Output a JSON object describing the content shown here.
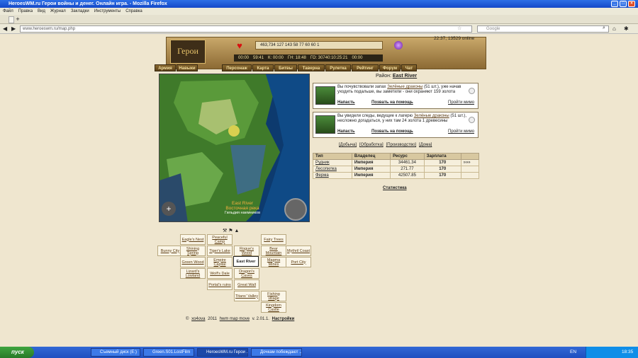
{
  "window": {
    "title": "HeroesWM.ru Герои войны и денег. Онлайн игра. - Mozilla Firefox"
  },
  "menubar": [
    "Файл",
    "Правка",
    "Вид",
    "Журнал",
    "Закладки",
    "Инструменты",
    "Справка"
  ],
  "browser": {
    "url": "www.heroeswm.ru/map.php",
    "search_placeholder": "Google"
  },
  "header": {
    "logo": "Герои",
    "online": "22:37, 13529 online",
    "resources": "463,734  127  143  58  77  60  60  1",
    "timers": [
      "00:00",
      "59:41",
      "К: 00:00",
      "ГН: 18:48",
      "ГО: 30740:10:25:21",
      "00:00"
    ]
  },
  "nav": [
    "Армия",
    "Навыки",
    "Персонаж",
    "Карта",
    "Битвы",
    "Таверна",
    "Рулетка",
    "Рейтинг",
    "Форум",
    "Чат"
  ],
  "map": {
    "label": "East River",
    "sub": "Восточная река",
    "sub2": "Гильдия наемников"
  },
  "region": {
    "label": "Район:",
    "name": "East River"
  },
  "events": [
    {
      "text_pre": "Вы почувствовали запах ",
      "link": "Зелёные драконы",
      "text_post": " (51 шт.), уже начав уходить подальше, вы заметили - они охраняют 159 золота",
      "attack": "Напасть",
      "help": "Позвать на помощь",
      "pass": "Пройти мимо"
    },
    {
      "text_pre": "Вы увидели следы, ведущие к лагерю ",
      "link": "Зелёные драконы",
      "text_post": " (51 шт.), несложно догадаться, у них там 24 золота 1 древесины",
      "attack": "Напасть",
      "help": "Позвать на помощь",
      "pass": "Пройти мимо"
    }
  ],
  "subtabs": [
    "[Добыча]",
    "[Обработка]",
    "[Производство]",
    "[Дома]"
  ],
  "table": {
    "headers": [
      "Тип",
      "Владелец",
      "Ресурс",
      "Зарплата",
      ""
    ],
    "rows": [
      [
        "Рудник",
        "Империя",
        "34461.34",
        "170",
        "»»»"
      ],
      [
        "Лесопилка",
        "Империя",
        "271.77",
        "170",
        ""
      ],
      [
        "Ферма",
        "Империя",
        "42507.85",
        "170",
        ""
      ]
    ]
  },
  "stat": "Статистика",
  "grid": {
    "eagle": "Eagle's Nest",
    "peaceful": "Peaceful Camp",
    "fairy": "Fairy Trees",
    "bunny": "Bunny City",
    "shining": "Shining Spring",
    "tiger": "Tiger's Lake",
    "rogues": "Rogue's Wood",
    "bear": "Bear Mountain",
    "mythril": "Mythril Coast",
    "green": "Green Wood",
    "empire": "Empire Capital",
    "east": "East River",
    "magma": "Magma Mines",
    "port": "Port City",
    "lizard": "Lizard's Lowland",
    "wolf": "Wolf's Dale",
    "dragon": "Dragon's Caves",
    "portal": "Portal's ruins",
    "wall": "Great Wall",
    "titans": "Titans' Valley",
    "fishing": "Fishing village",
    "kingdom": "Kingdom Castle"
  },
  "footer": {
    "copy": "© ",
    "author": "xo4ova",
    "year": " 2011 ",
    "app": "hwm map move",
    "ver": " v. 2.01.1. ",
    "settings": "Настройки"
  },
  "taskbar": {
    "start": "пуск",
    "tasks": [
      "Съемный диск (E:)",
      "Green.S01.LostFilm",
      "HeroesWM.ru Герои ...",
      "Дочкам побеждают ..."
    ],
    "lang": "EN",
    "clock": "18:35"
  }
}
